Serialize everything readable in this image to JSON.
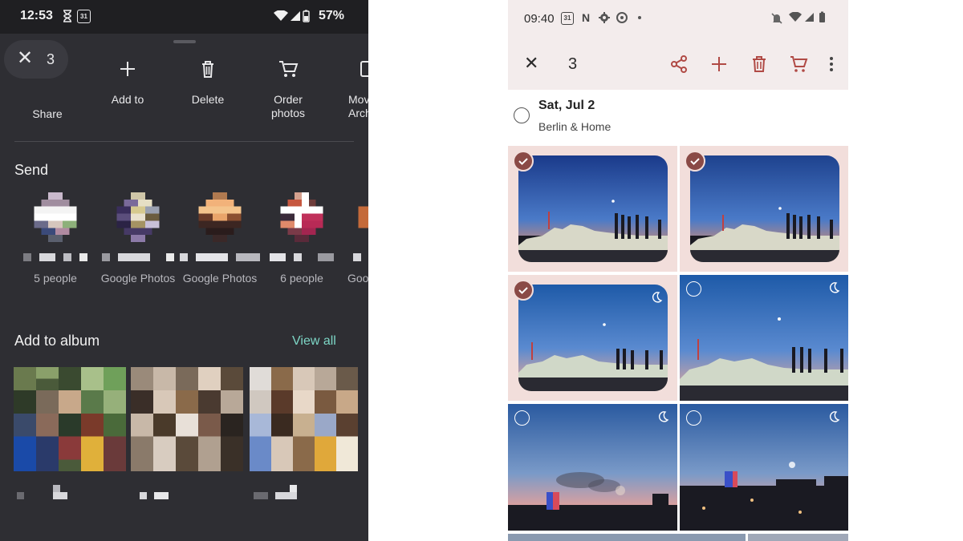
{
  "left_panel": {
    "status": {
      "time": "12:53",
      "calendar_day": "31",
      "battery": "57%"
    },
    "selection": {
      "close_icon": "close-icon",
      "count": "3"
    },
    "actions": [
      {
        "label": "Share",
        "icon": "share-icon"
      },
      {
        "label": "Add to",
        "icon": "plus-icon"
      },
      {
        "label": "Delete",
        "icon": "trash-icon"
      },
      {
        "label": "Order\nphotos",
        "icon": "cart-icon"
      },
      {
        "label": "Mov\nArch",
        "icon": "archive-icon"
      }
    ],
    "send": {
      "title": "Send",
      "items": [
        {
          "name": "5 people"
        },
        {
          "name": "Google Photos"
        },
        {
          "name": "Google Photos"
        },
        {
          "name": "6 people"
        },
        {
          "name": "Goo"
        }
      ]
    },
    "album": {
      "title": "Add to album",
      "view_all": "View all"
    }
  },
  "right_panel": {
    "status": {
      "time": "09:40",
      "calendar_day": "31"
    },
    "toolbar": {
      "count": "3",
      "close_icon": "close-icon",
      "share_icon": "share-icon",
      "add_icon": "plus-icon",
      "delete_icon": "trash-icon",
      "order_icon": "cart-icon",
      "more_icon": "more-vert-icon"
    },
    "date_group": {
      "title": "Sat, Jul 2",
      "subtitle": "Berlin & Home"
    },
    "photos": [
      {
        "selected": true,
        "night_sight": false
      },
      {
        "selected": true,
        "night_sight": false
      },
      {
        "selected": true,
        "night_sight": true
      },
      {
        "selected": false,
        "night_sight": true
      },
      {
        "selected": false,
        "night_sight": true
      },
      {
        "selected": false,
        "night_sight": true
      }
    ]
  },
  "colors": {
    "dark_sheet": "#2e2e33",
    "accent_teal": "#7dd6c6",
    "selected_tile": "#f2dedb",
    "check_badge": "#8a4a46",
    "toolbar_red": "#b04a45"
  }
}
